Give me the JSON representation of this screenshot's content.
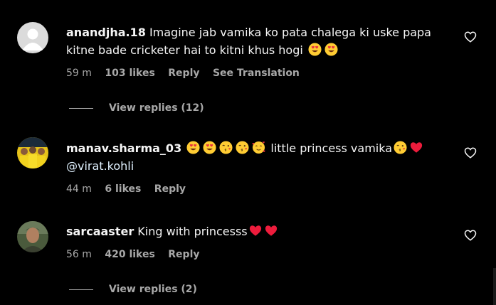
{
  "comments": [
    {
      "username": "anandjha.18",
      "text": "Imagine jab vamika ko pata chalega ki uske papa kitne bade cricketer hai to kitni khus hogi",
      "emojis": [
        "heart-eyes-emoji",
        "heart-eyes-emoji"
      ],
      "time": "59 m",
      "likes": "103 likes",
      "reply_label": "Reply",
      "translation_label": "See Translation",
      "view_replies": "View replies (12)"
    },
    {
      "username": "manav.sharma_03",
      "emojis_lead": [
        "heart-eyes-emoji",
        "heart-eyes-emoji",
        "kiss-wink-emoji",
        "kiss-wink-emoji",
        "smiling-hearts-emoji"
      ],
      "text": "little princess vamika",
      "emojis_trail": [
        "kiss-wink-emoji",
        "red-heart-emoji"
      ],
      "mention": "@virat.kohli",
      "time": "44 m",
      "likes": "6 likes",
      "reply_label": "Reply"
    },
    {
      "username": "sarcaaster",
      "text": "King with princesss",
      "emojis": [
        "red-heart-emoji",
        "red-heart-emoji"
      ],
      "time": "56 m",
      "likes": "420 likes",
      "reply_label": "Reply",
      "view_replies": "View replies (2)"
    }
  ],
  "colors": {
    "background": "#000000",
    "primary_text": "#f5f5f5",
    "secondary_text": "#a8a8a8",
    "heart": "#ed1c3c",
    "emoji_face": "#ffcc33"
  }
}
